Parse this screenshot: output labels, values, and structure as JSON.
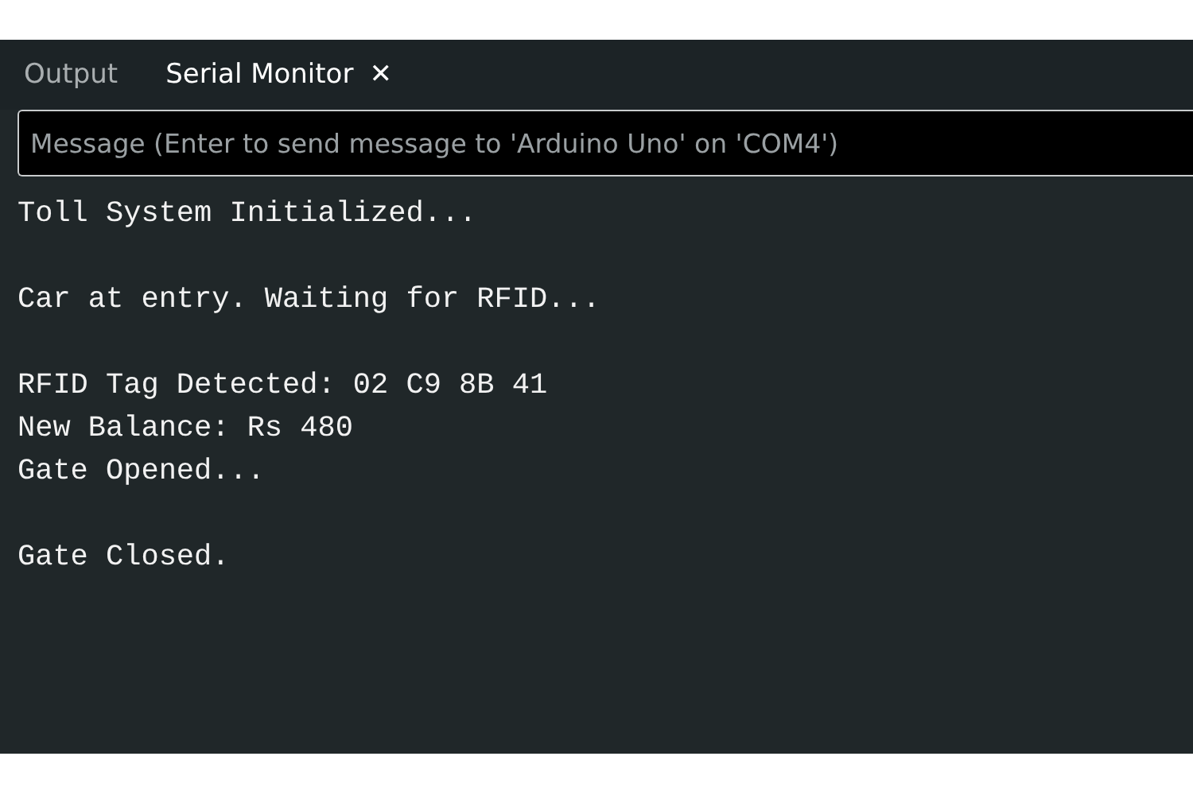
{
  "tabs": [
    {
      "label": "Output",
      "selected": false
    },
    {
      "label": "Serial Monitor",
      "selected": true,
      "close": "✕"
    }
  ],
  "message_field": {
    "placeholder": "Message (Enter to send message to 'Arduino Uno' on 'COM4')"
  },
  "console": {
    "blocks": [
      [
        "Toll System Initialized..."
      ],
      [
        "Car at entry. Waiting for RFID..."
      ],
      [
        "RFID Tag Detected: 02 C9 8B 41",
        "New Balance: Rs 480",
        "Gate Opened..."
      ],
      [
        "Gate Closed."
      ]
    ]
  }
}
